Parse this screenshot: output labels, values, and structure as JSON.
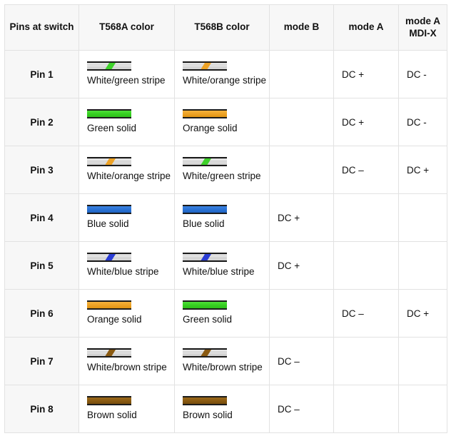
{
  "table": {
    "columns": [
      {
        "key": "pin",
        "label": "Pins at switch"
      },
      {
        "key": "t568a",
        "label": "T568A color"
      },
      {
        "key": "t568b",
        "label": "T568B color"
      },
      {
        "key": "modeb",
        "label": "mode B"
      },
      {
        "key": "modea",
        "label": "mode A"
      },
      {
        "key": "modex",
        "label": "mode A\nMDI-X"
      }
    ],
    "header": {
      "pin": "Pins at switch",
      "t568a": "T568A color",
      "t568b": "T568B color",
      "modeb": "mode B",
      "modea": "mode A",
      "modex_line1": "mode A",
      "modex_line2": "MDI-X"
    },
    "rows": [
      {
        "pin": "Pin 1",
        "t568a": {
          "label": "White/green stripe",
          "style": "striped",
          "color": "green"
        },
        "t568b": {
          "label": "White/orange stripe",
          "style": "striped",
          "color": "orange"
        },
        "modeb": "",
        "modea": "DC +",
        "modex": "DC -"
      },
      {
        "pin": "Pin 2",
        "t568a": {
          "label": "Green solid",
          "style": "solid",
          "color": "green"
        },
        "t568b": {
          "label": "Orange solid",
          "style": "solid",
          "color": "orange"
        },
        "modeb": "",
        "modea": "DC +",
        "modex": "DC -"
      },
      {
        "pin": "Pin 3",
        "t568a": {
          "label": "White/orange stripe",
          "style": "striped",
          "color": "orange"
        },
        "t568b": {
          "label": "White/green stripe",
          "style": "striped",
          "color": "green"
        },
        "modeb": "",
        "modea": "DC –",
        "modex": "DC +"
      },
      {
        "pin": "Pin 4",
        "t568a": {
          "label": "Blue solid",
          "style": "solid",
          "color": "blue"
        },
        "t568b": {
          "label": "Blue solid",
          "style": "solid",
          "color": "blue"
        },
        "modeb": "DC +",
        "modea": "",
        "modex": ""
      },
      {
        "pin": "Pin 5",
        "t568a": {
          "label": "White/blue stripe",
          "style": "striped",
          "color": "blue"
        },
        "t568b": {
          "label": "White/blue stripe",
          "style": "striped",
          "color": "blue"
        },
        "modeb": "DC +",
        "modea": "",
        "modex": ""
      },
      {
        "pin": "Pin 6",
        "t568a": {
          "label": "Orange solid",
          "style": "solid",
          "color": "orange"
        },
        "t568b": {
          "label": "Green solid",
          "style": "solid",
          "color": "green"
        },
        "modeb": "",
        "modea": "DC –",
        "modex": "DC +"
      },
      {
        "pin": "Pin 7",
        "t568a": {
          "label": "White/brown stripe",
          "style": "striped",
          "color": "brown"
        },
        "t568b": {
          "label": "White/brown stripe",
          "style": "striped",
          "color": "brown"
        },
        "modeb": "DC –",
        "modea": "",
        "modex": ""
      },
      {
        "pin": "Pin 8",
        "t568a": {
          "label": "Brown solid",
          "style": "solid",
          "color": "brown"
        },
        "t568b": {
          "label": "Brown solid",
          "style": "solid",
          "color": "brown"
        },
        "modeb": "DC –",
        "modea": "",
        "modex": ""
      }
    ]
  },
  "colors": {
    "green": "#3ed12a",
    "orange": "#eda226",
    "blue_solid": "#2a72d4",
    "blue_stripe": "#2a3cd4",
    "brown": "#8a5a11",
    "header_bg": "#f7f7f7",
    "border": "#e2e2e2",
    "text": "#111111"
  }
}
